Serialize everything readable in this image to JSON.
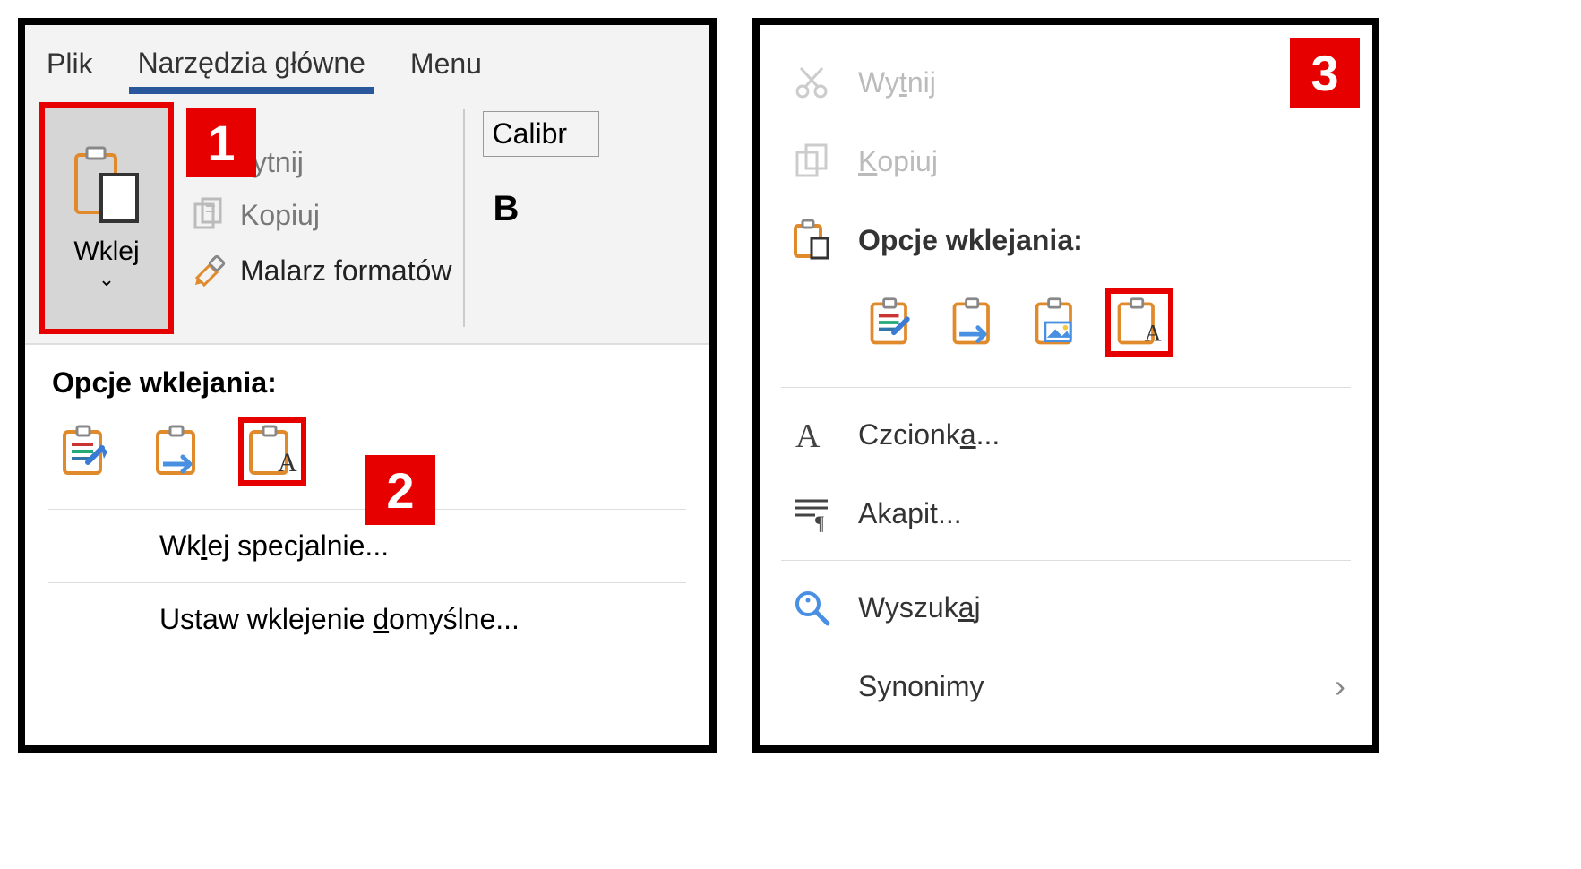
{
  "tabs": {
    "file": "Plik",
    "home": "Narzędzia główne",
    "menu": "Menu"
  },
  "ribbon": {
    "paste_label": "Wklej",
    "cut": "Wytnij",
    "copy": "Kopiuj",
    "format_painter": "Malarz formatów",
    "font_name": "Calibr",
    "bold": "B"
  },
  "dropdown": {
    "title": "Opcje wklejania:",
    "paste_special": "Wklej specjalnie...",
    "set_default": "Ustaw wklejenie domyślne..."
  },
  "context": {
    "cut": "Wytnij",
    "copy": "Kopiuj",
    "paste_options": "Opcje wklejania:",
    "font": "Czcionka...",
    "paragraph": "Akapit...",
    "search": "Wyszukaj",
    "synonyms": "Synonimy"
  },
  "badges": {
    "b1": "1",
    "b2": "2",
    "b3": "3"
  }
}
